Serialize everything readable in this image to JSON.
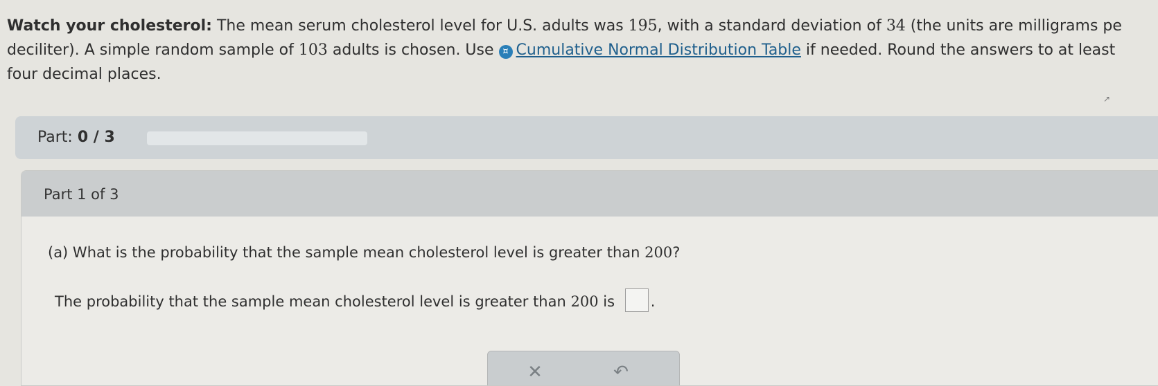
{
  "problem": {
    "title": "Watch your cholesterol:",
    "text_1": " The mean serum cholesterol level for U.S. adults was ",
    "mean": "195",
    "text_2": ", with a standard deviation of ",
    "sd": "34",
    "text_3": " (the units are milligrams pe",
    "text_4": "deciliter). A simple random sample of ",
    "sample_size": "103",
    "text_5": " adults is chosen. Use ",
    "table_link": "Cumulative Normal Distribution Table",
    "text_6": " if needed. Round the answers to at least",
    "text_7": "four decimal places."
  },
  "part_bar": {
    "label": "Part: ",
    "progress_text": "0 / 3",
    "progress_fraction": 0
  },
  "part_card": {
    "title": "Part 1 of 3",
    "question_prefix": "(a) What is the probability that the sample mean cholesterol level is greater than ",
    "threshold": "200",
    "question_suffix": "?",
    "answer_prefix": "The probability that the sample mean cholesterol level is greater than ",
    "answer_threshold": "200",
    "answer_middle": " is ",
    "answer_suffix": "."
  },
  "buttons": {
    "clear_glyph": "✕",
    "undo_glyph": "↶"
  },
  "cursor_glyph": "↗",
  "colors": {
    "accent": "#2a7fb8",
    "link": "#1f5f8c"
  },
  "icons": [
    "info-circle-icon",
    "clear-x-icon",
    "undo-icon"
  ]
}
